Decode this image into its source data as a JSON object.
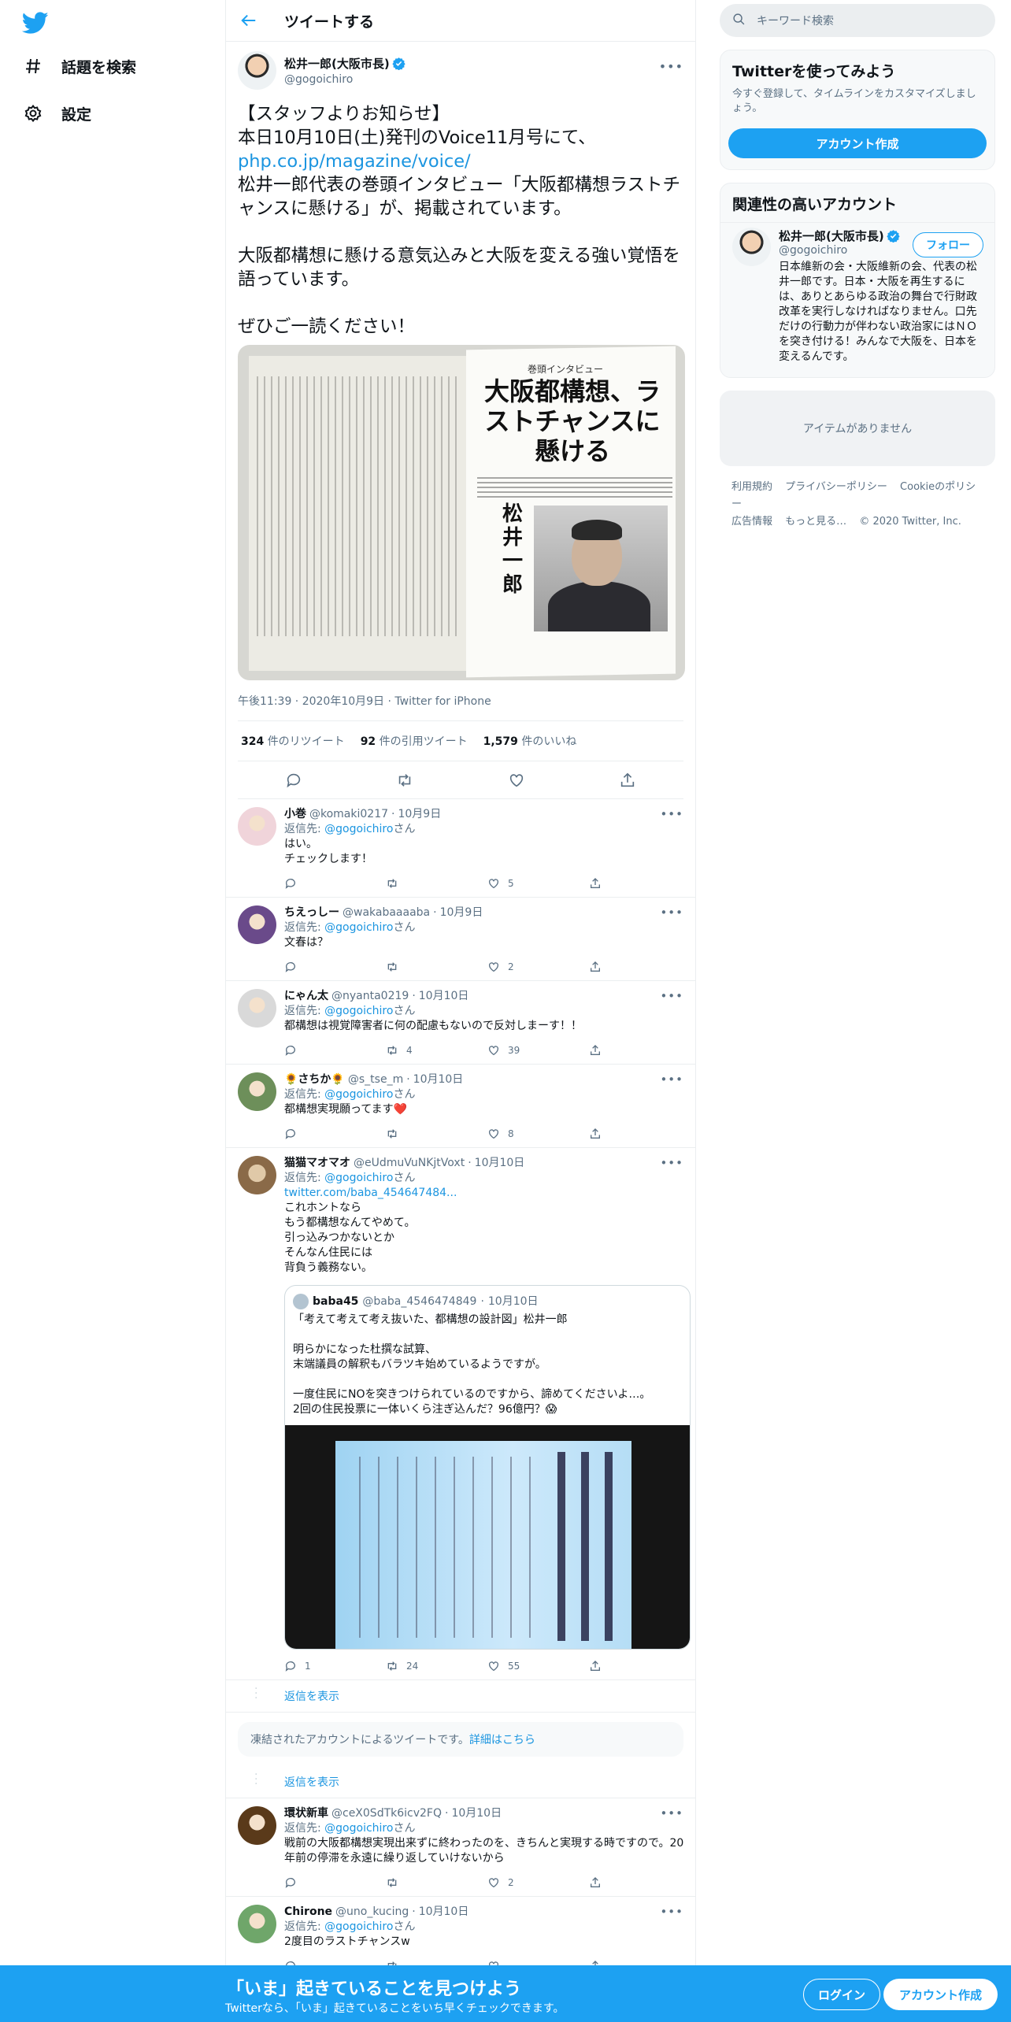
{
  "nav": {
    "logo_icon": "twitter-bird-icon",
    "explore_label": "話題を検索",
    "settings_label": "設定"
  },
  "header": {
    "title": "ツイートする"
  },
  "tweet": {
    "author_name": "松井一郎(大阪市長)",
    "author_handle": "@gogoichiro",
    "text_part1": "【スタッフよりお知らせ】\n本日10月10日(土)発刊のVoice11月号にて、\n",
    "link": "php.co.jp/magazine/voice/",
    "text_part2": "\n松井一郎代表の巻頭インタビュー「大阪都構想ラストチャンスに懸ける」が、掲載されています。\n\n大阪都構想に懸ける意気込みと大阪を変える強い覚悟を語っています。\n\nぜひご一読ください！",
    "photo": {
      "subtitle": "巻頭インタビュー",
      "headline": "大阪都構想、ラストチャンスに懸ける",
      "name": "松井一郎"
    },
    "timestamp": "午後11:39 · 2020年10月9日 · Twitter for iPhone",
    "stats": {
      "retweets_count": "324",
      "retweets_label": "件のリツイート",
      "quotes_count": "92",
      "quotes_label": "件の引用ツイート",
      "likes_count": "1,579",
      "likes_label": "件のいいね"
    }
  },
  "reply_to_label": "返信先:",
  "reply_to_mention": "@gogoichiro",
  "reply_to_suffix": "さん",
  "replies": [
    {
      "name": "小巻",
      "handle": "@komaki0217",
      "date": "10月9日",
      "text": "はい。\nチェックします！",
      "replies": "",
      "retweets": "",
      "likes": "5",
      "avatar_color": "#f0d4da"
    },
    {
      "name": "ちえっしー",
      "handle": "@wakabaaaaba",
      "date": "10月9日",
      "text": "文春は？",
      "replies": "",
      "retweets": "",
      "likes": "2",
      "avatar_color": "#6a4a8a"
    },
    {
      "name": "にゃん太",
      "handle": "@nyanta0219",
      "date": "10月10日",
      "text": "都構想は視覚障害者に何の配慮もないので反対しまーす！！",
      "replies": "",
      "retweets": "4",
      "likes": "39",
      "avatar_color": "#d9d9d9"
    },
    {
      "name": "🌻さちか🌻",
      "handle": "@s_tse_m",
      "date": "10月10日",
      "text": "都構想実現願ってます❤️",
      "replies": "",
      "retweets": "",
      "likes": "8",
      "avatar_color": "#6d8f5a"
    }
  ],
  "quote_reply": {
    "name": "猫猫マオマオ",
    "handle": "@eUdmuVuNKjtVoxt",
    "date": "10月10日",
    "link": "twitter.com/baba_454647484...",
    "text": "これホントなら\nもう都構想なんてやめて。\n引っ込みつかないとか\nそんなん住民には\n背負う義務ない。",
    "quoted": {
      "name": "baba45",
      "handle": "@baba_4546474849",
      "date": "10月10日",
      "text": "「考えて考えて考え抜いた、都構想の設計図」松井一郎\n\n明らかになった杜撰な試算、\n末端議員の解釈もバラツキ始めているようですが。\n\n一度住民にNOを突きつけられているのですから、諦めてくださいよ…。\n2回の住民投票に一体いくら注ぎ込んだ？96億円？😱"
    },
    "replies": "1",
    "retweets": "24",
    "likes": "55",
    "avatar_color": "#a88a6a"
  },
  "show_replies_label": "返信を表示",
  "suspended": {
    "text": "凍結されたアカウントによるツイートです。",
    "link": "詳細はこちら"
  },
  "replies2": [
    {
      "name": "環状新車",
      "handle": "@ceX0SdTk6icv2FQ",
      "date": "10月10日",
      "text": "戦前の大阪都構想実現出来ずに終わったのを、きちんと実現する時ですので。20年前の停滞を永遠に繰り返していけないから",
      "replies": "",
      "retweets": "",
      "likes": "2",
      "avatar_color": "#5a3a1a"
    },
    {
      "name": "Chirone",
      "handle": "@uno_kucing",
      "date": "10月10日",
      "text": "2度目のラストチャンスw",
      "replies": "",
      "retweets": "",
      "likes": "",
      "avatar_color": "#6fa66a"
    }
  ],
  "sidebar": {
    "search_placeholder": "キーワード検索",
    "signup_card": {
      "title": "Twitterを使ってみよう",
      "subtitle": "今すぐ登録して、タイムラインをカスタマイズしましょう。",
      "button": "アカウント作成"
    },
    "related": {
      "title": "関連性の高いアカウント",
      "name": "松井一郎(大阪市長)",
      "handle": "@gogoichiro",
      "bio": "日本維新の会・大阪維新の会、代表の松井一郎です。日本・大阪を再生するには、ありとあらゆる政治の舞台で行財政改革を実行しなければなりません。口先だけの行動力が伴わない政治家にはＮＯを突き付ける！みんなで大阪を、日本を変えるんです。",
      "follow": "フォロー"
    },
    "empty_text": "アイテムがありません",
    "footer": {
      "terms": "利用規約",
      "privacy": "プライバシーポリシー",
      "cookies": "Cookieのポリシー",
      "ads": "広告情報",
      "more": "もっと見る…",
      "copyright": "© 2020 Twitter, Inc."
    }
  },
  "bottom_bar": {
    "title": "「いま」起きていることを見つけよう",
    "subtitle": "Twitterなら、「いま」起きていることをいち早くチェックできます。",
    "login": "ログイン",
    "signup": "アカウント作成"
  },
  "colors": {
    "accent": "#1da1f2",
    "link": "#1b95e0",
    "muted": "#5b7083",
    "border": "#ebeef0"
  }
}
